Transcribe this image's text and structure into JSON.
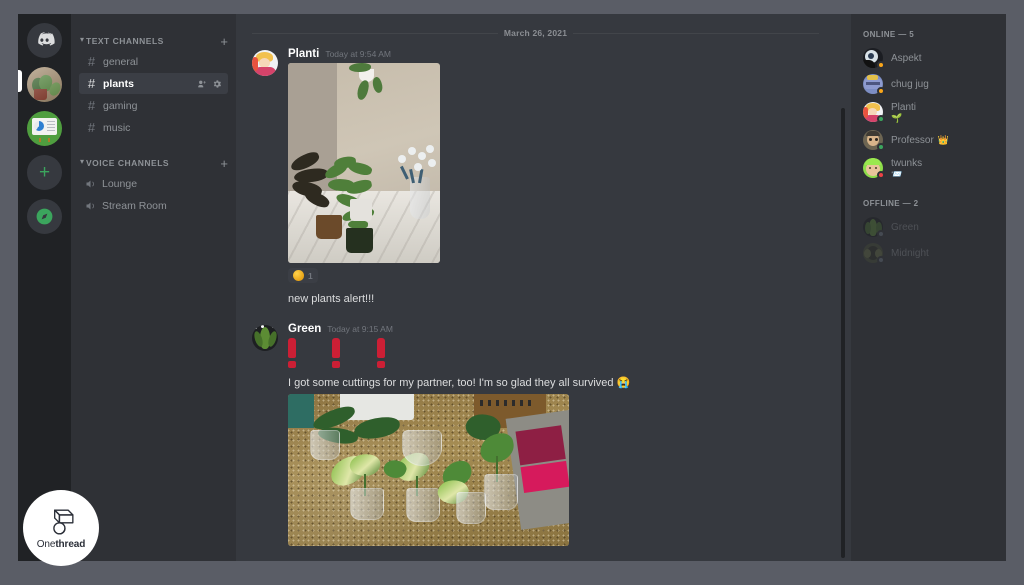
{
  "app": {
    "name": "Discord"
  },
  "server_rail": {
    "items": [
      {
        "name": "discord-home",
        "icon": "discord-logo-icon",
        "active": false
      },
      {
        "name": "plants-server",
        "icon": "plant-server-icon",
        "active": true
      },
      {
        "name": "board-server",
        "icon": "board-server-icon",
        "active": false
      },
      {
        "name": "add-server",
        "icon": "plus-icon",
        "label": "+",
        "active": false
      },
      {
        "name": "explore-servers",
        "icon": "compass-icon",
        "active": false
      }
    ]
  },
  "channel_sidebar": {
    "categories": [
      {
        "label": "TEXT CHANNELS",
        "add_label": "+",
        "arrow": "▾",
        "channels": [
          {
            "name": "general",
            "prefix": "#",
            "active": false
          },
          {
            "name": "plants",
            "prefix": "#",
            "active": true,
            "icons": [
              "add-member-icon",
              "settings-gear-icon"
            ]
          },
          {
            "name": "gaming",
            "prefix": "#",
            "active": false
          },
          {
            "name": "music",
            "prefix": "#",
            "active": false
          }
        ]
      },
      {
        "label": "VOICE CHANNELS",
        "add_label": "+",
        "arrow": "▾",
        "channels": [
          {
            "name": "Lounge",
            "prefix": "speaker",
            "active": false
          },
          {
            "name": "Stream Room",
            "prefix": "speaker",
            "active": false
          }
        ]
      }
    ]
  },
  "chat": {
    "date_divider": "March 26, 2021",
    "messages": [
      {
        "author": "Planti",
        "timestamp": "Today at 9:54 AM",
        "attachment_alt": "photo of potted plants on a white marble counter",
        "reaction": {
          "emoji": "clap",
          "count": "1"
        },
        "text": "new plants alert!!!"
      },
      {
        "author": "Green",
        "timestamp": "Today at 9:15 AM",
        "jumbo_emoji": "❗❗❗",
        "text": "I got some cuttings for my partner, too! I'm so glad they all survived 😭",
        "attachment_alt": "photo of plant cuttings in glass jars on a granite counter"
      }
    ]
  },
  "members": {
    "online_header": "ONLINE — 5",
    "offline_header": "OFFLINE — 2",
    "online": [
      {
        "name": "Aspekt",
        "status": "idle",
        "status_color": "#faa61a",
        "badge": "",
        "sub": ""
      },
      {
        "name": "chug jug",
        "status": "idle",
        "status_color": "#faa61a",
        "badge": "",
        "sub": ""
      },
      {
        "name": "Planti",
        "status": "online",
        "status_color": "#3ba55d",
        "badge": "",
        "sub": "🌱"
      },
      {
        "name": "Professor",
        "status": "online",
        "status_color": "#3ba55d",
        "badge": "👑",
        "sub": ""
      },
      {
        "name": "twunks",
        "status": "dnd",
        "status_color": "#ed4245",
        "badge": "",
        "sub": "📨"
      }
    ],
    "offline": [
      {
        "name": "Green",
        "status": "offline",
        "status_color": "#747f8d"
      },
      {
        "name": "Midnight",
        "status": "offline",
        "status_color": "#747f8d"
      }
    ]
  },
  "watermark": {
    "prefix": "One",
    "suffix": "thread"
  },
  "colors": {
    "rail_bg": "#202225",
    "sidebar_bg": "#2f3136",
    "chat_bg": "#36393f",
    "accent_green": "#3ba55d",
    "idle": "#faa61a",
    "dnd": "#ed4245",
    "outer": "#5a5d66"
  }
}
